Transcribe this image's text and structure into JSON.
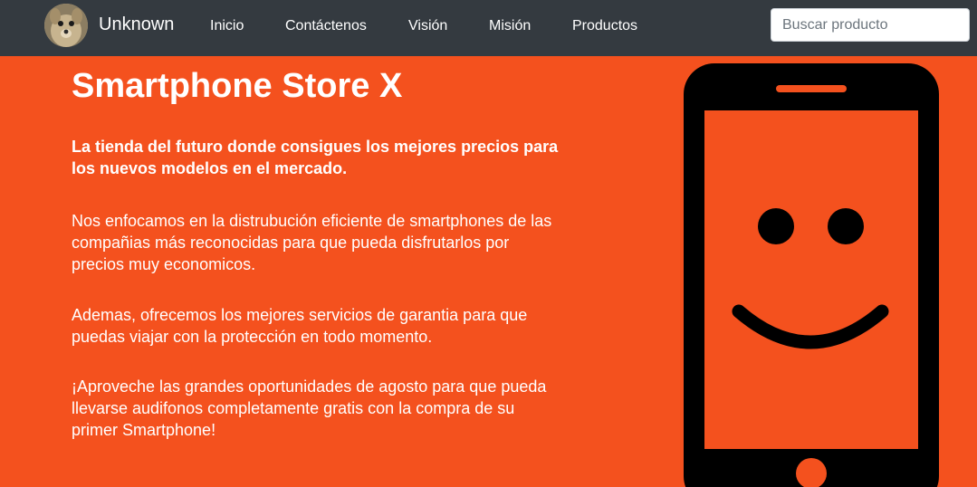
{
  "navbar": {
    "brand": "Unknown",
    "links": [
      "Inicio",
      "Contáctenos",
      "Visión",
      "Misión",
      "Productos"
    ],
    "search_placeholder": "Buscar producto"
  },
  "hero": {
    "title": "Smartphone Store X",
    "tagline": "La tienda del futuro donde consigues los mejores precios para los nuevos modelos en el mercado.",
    "paragraphs": [
      "Nos enfocamos en la distrubución eficiente de smartphones de las compañias más reconocidas para que pueda disfrutarlos por precios muy economicos.",
      "Ademas, ofrecemos los mejores servicios de garantia para que puedas viajar con la protección en todo momento.",
      "¡Aproveche las grandes oportunidades de agosto para que pueda llevarse audifonos completamente gratis con la compra de su primer Smartphone!"
    ]
  },
  "colors": {
    "navbar_bg": "#343a40",
    "page_bg": "#f4511e",
    "phone_body": "#000000",
    "text": "#ffffff"
  },
  "icons": {
    "avatar": "dog-photo-avatar",
    "illustration": "smiling-smartphone-icon"
  }
}
